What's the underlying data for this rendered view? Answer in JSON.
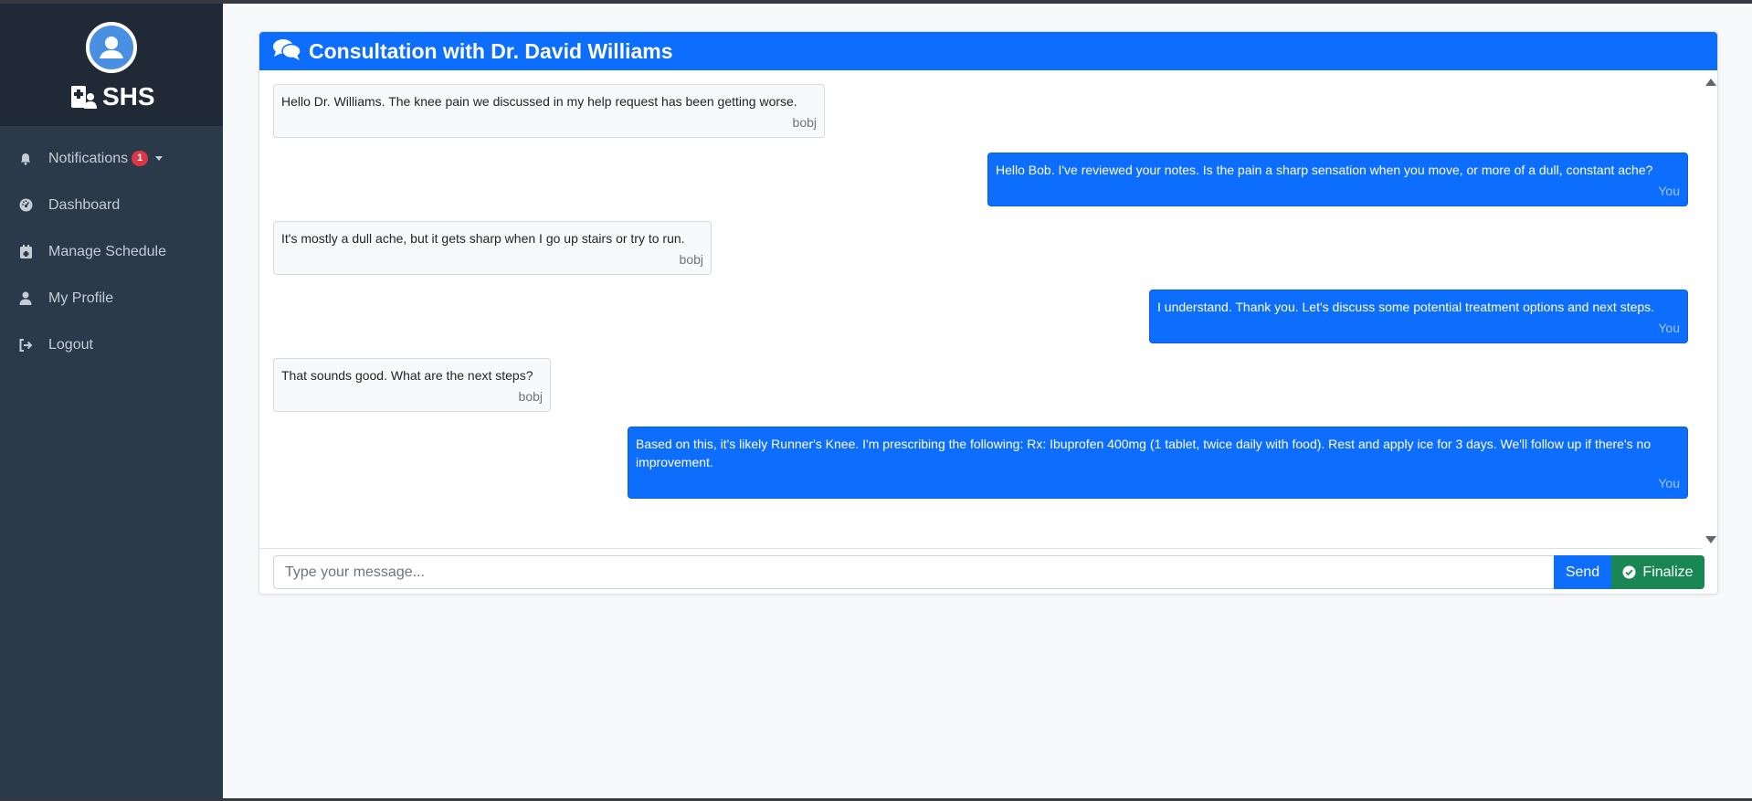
{
  "app": {
    "brand": "SHS",
    "colors": {
      "primary": "#0d6efd",
      "success": "#198754",
      "danger": "#dc3545",
      "sidebar": "#2b3a4a"
    }
  },
  "sidebar": {
    "items": [
      {
        "label": "Notifications",
        "icon": "bell-icon",
        "badge": "1"
      },
      {
        "label": "Dashboard",
        "icon": "gauge-icon"
      },
      {
        "label": "Manage Schedule",
        "icon": "calendar-icon"
      },
      {
        "label": "My Profile",
        "icon": "user-icon"
      },
      {
        "label": "Logout",
        "icon": "logout-icon"
      }
    ]
  },
  "chat": {
    "title": "Consultation with Dr. David Williams",
    "messages": [
      {
        "direction": "in",
        "text": "Hello Dr. Williams. The knee pain we discussed in my help request has been getting worse.",
        "sender": "bobj"
      },
      {
        "direction": "out",
        "text": "Hello Bob. I've reviewed your notes. Is the pain a sharp sensation when you move, or more of a dull, constant ache?",
        "sender": "You"
      },
      {
        "direction": "in",
        "text": "It's mostly a dull ache, but it gets sharp when I go up stairs or try to run.",
        "sender": "bobj"
      },
      {
        "direction": "out",
        "text": "I understand. Thank you. Let's discuss some potential treatment options and next steps.",
        "sender": "You"
      },
      {
        "direction": "in",
        "text": "That sounds good. What are the next steps?",
        "sender": "bobj"
      },
      {
        "direction": "out",
        "text": "Based on this, it's likely Runner's Knee. I'm prescribing the following: Rx: Ibuprofen 400mg (1 tablet, twice daily with food). Rest and apply ice for 3 days. We'll follow up if there's no improvement.",
        "sender": "You"
      }
    ],
    "input_placeholder": "Type your message...",
    "input_value": "",
    "send_label": "Send",
    "finalize_label": "Finalize"
  }
}
